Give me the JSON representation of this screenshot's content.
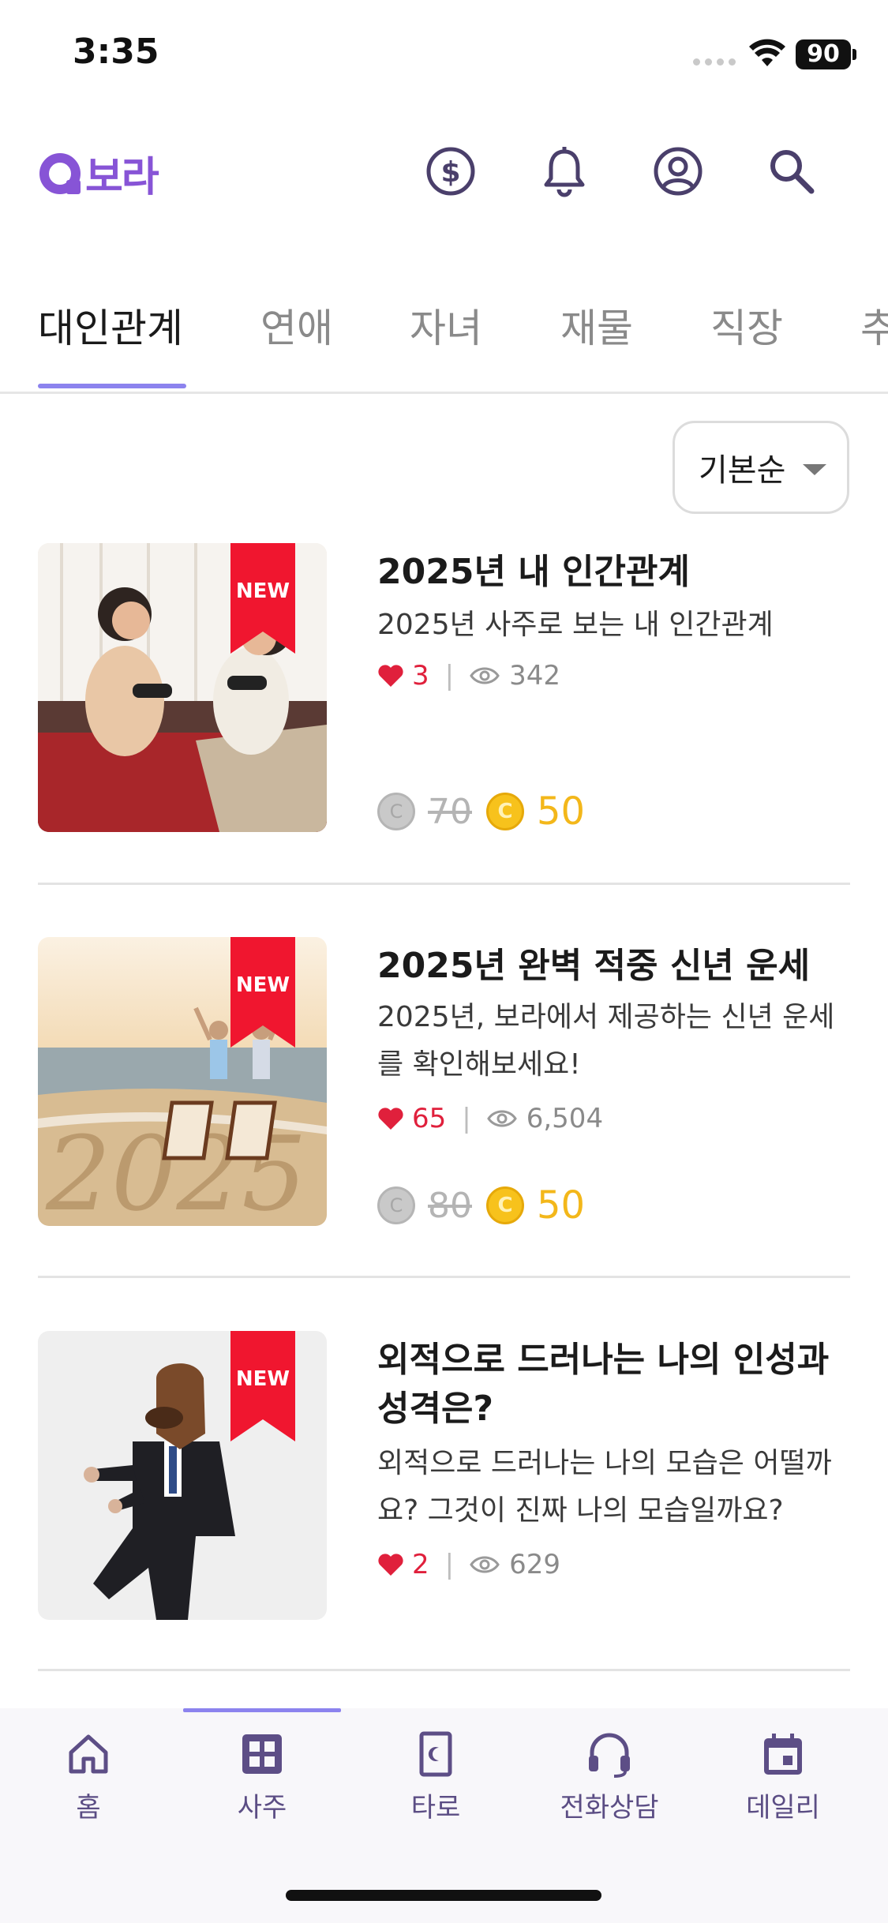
{
  "status_bar": {
    "time": "3:35",
    "battery": "90"
  },
  "header": {
    "logo_text": "보라",
    "icons": [
      "coin-icon",
      "bell-icon",
      "profile-icon",
      "search-icon"
    ]
  },
  "tabs": {
    "items": [
      "대인관계",
      "연애",
      "자녀",
      "재물",
      "직장",
      "추"
    ],
    "active": "대인관계"
  },
  "sort": {
    "label": "기본순"
  },
  "badge": {
    "new_label": "NEW"
  },
  "items": [
    {
      "title": "2025년 내 인간관계",
      "description": "2025년 사주로 보는 내 인간관계",
      "likes": "3",
      "views": "342",
      "original_price": "70",
      "price": "50"
    },
    {
      "title": "2025년 완벽 적중 신년 운세",
      "description": "2025년, 보라에서 제공하는 신년 운세를 확인해보세요!",
      "likes": "65",
      "views": "6,504",
      "original_price": "80",
      "price": "50"
    },
    {
      "title": "외적으로 드러나는 나의 인성과 성격은?",
      "description": "외적으로 드러나는 나의 모습은 어떨까요? 그것이 진짜 나의 모습일까요?",
      "likes": "2",
      "views": "629"
    }
  ],
  "bottom_nav": {
    "items": [
      "홈",
      "사주",
      "타로",
      "전화상담",
      "데일리"
    ],
    "active": "사주"
  },
  "colors": {
    "brand": "#8754d6",
    "accent_underline": "#8c83ee",
    "like": "#e0203c",
    "coin": "#f7c21c",
    "ribbon": "#f0162f"
  }
}
